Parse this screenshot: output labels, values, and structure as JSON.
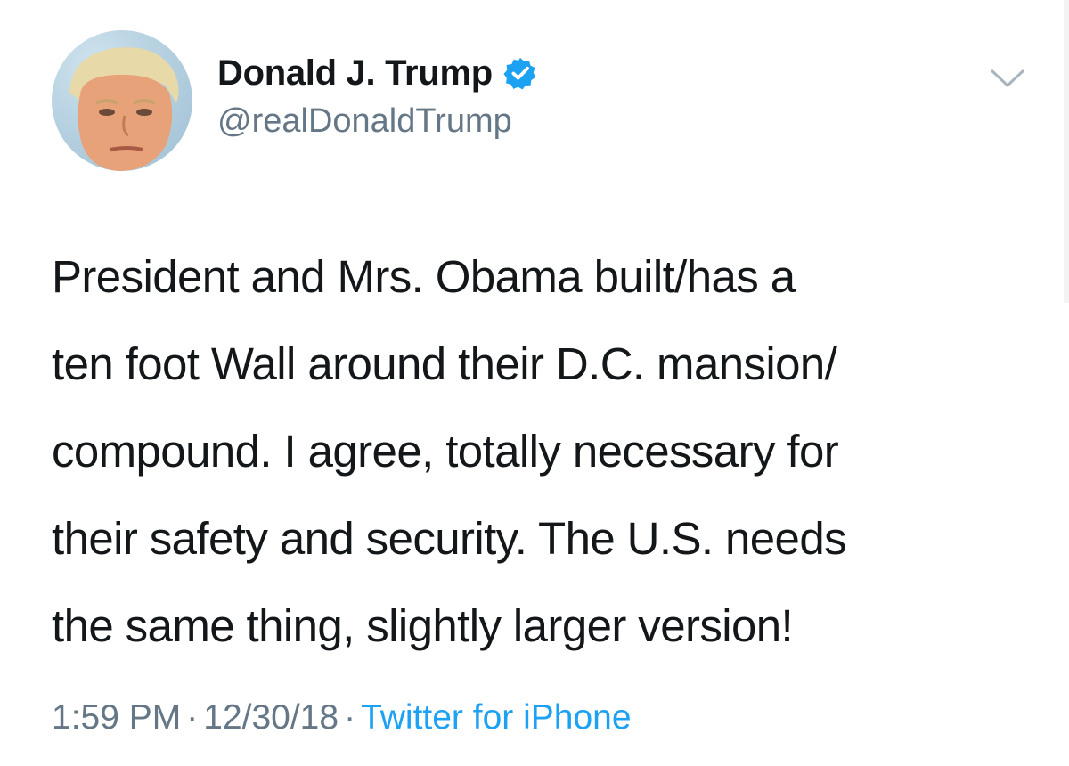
{
  "tweet": {
    "author": {
      "display_name": "Donald J. Trump",
      "handle": "@realDonaldTrump",
      "verified": true,
      "avatar_icon": "profile-photo"
    },
    "text": "President and Mrs. Obama built/has a\nten foot Wall around their D.C. mansion/\ncompound. I agree, totally necessary for\ntheir safety and security. The U.S. needs\nthe same thing, slightly larger version!",
    "time": "1:59 PM",
    "separator": "·",
    "date": "12/30/18",
    "source": "Twitter for iPhone",
    "menu_icon": "chevron-down-icon"
  },
  "colors": {
    "text": "#14171a",
    "secondary": "#657786",
    "accent": "#1da1f2",
    "background": "#ffffff"
  }
}
